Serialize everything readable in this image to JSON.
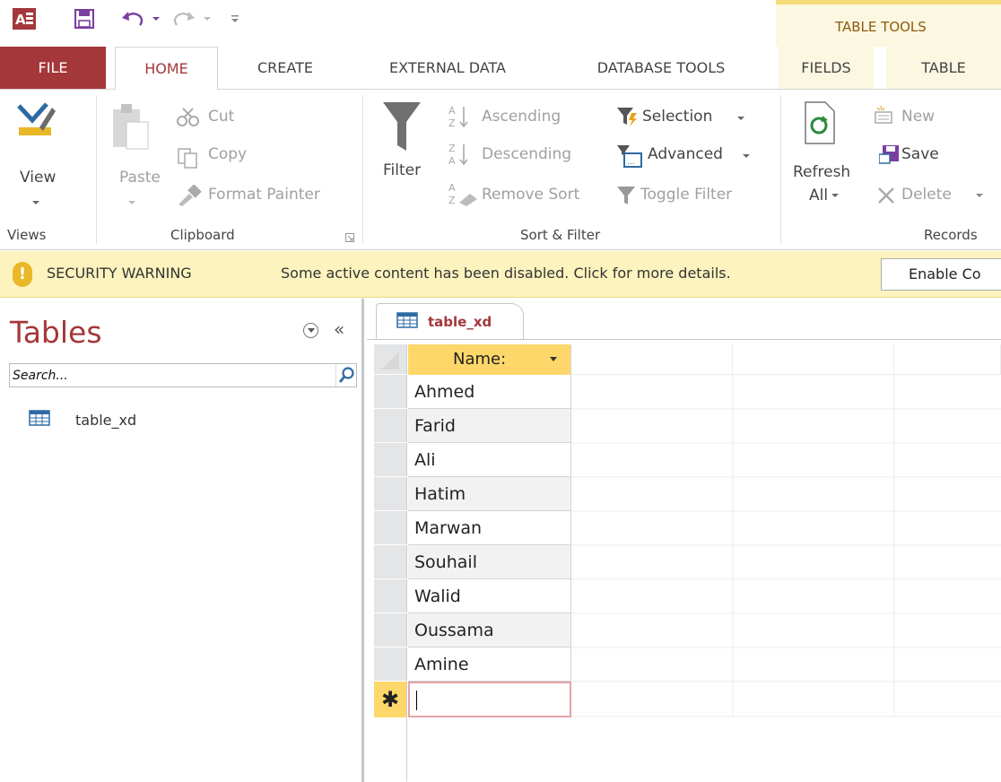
{
  "quick_access": {
    "app_icon": "access-app-icon",
    "save_icon": "save-icon",
    "undo_icon": "undo-icon",
    "redo_icon": "redo-icon",
    "customize_icon": "customize-toolbar-icon"
  },
  "contextual_tab_group": "TABLE TOOLS",
  "tabs": {
    "file": "FILE",
    "home": "HOME",
    "create": "CREATE",
    "external_data": "EXTERNAL DATA",
    "database_tools": "DATABASE TOOLS",
    "fields": "FIELDS",
    "table": "TABLE"
  },
  "ribbon": {
    "views": {
      "view": "View",
      "group": "Views"
    },
    "clipboard": {
      "paste": "Paste",
      "cut": "Cut",
      "copy": "Copy",
      "format_painter": "Format Painter",
      "group": "Clipboard"
    },
    "sort_filter": {
      "filter": "Filter",
      "ascending": "Ascending",
      "descending": "Descending",
      "remove_sort": "Remove Sort",
      "selection": "Selection",
      "advanced": "Advanced",
      "toggle_filter": "Toggle Filter",
      "group": "Sort & Filter"
    },
    "records": {
      "refresh": "Refresh",
      "refresh_all": "All",
      "new": "New",
      "save": "Save",
      "delete": "Delete",
      "group": "Records"
    }
  },
  "security_warning": {
    "title": "SECURITY WARNING",
    "message": "Some active content has been disabled. Click for more details.",
    "button": "Enable Co"
  },
  "nav_pane": {
    "title": "Tables",
    "search_placeholder": "Search...",
    "items": [
      {
        "label": "table_xd",
        "icon": "table-icon"
      }
    ]
  },
  "document": {
    "tab_label": "table_xd",
    "column_header": "Name:",
    "rows": [
      "Ahmed",
      "Farid",
      "Ali",
      "Hatim",
      "Marwan",
      "Souhail",
      "Walid",
      "Oussama",
      "Amine"
    ],
    "new_record_marker": "✱"
  },
  "colors": {
    "access_red": "#a4373a",
    "header_yellow": "#fdd769",
    "warning_bar": "#fdf3be",
    "context_tab_bg": "#fcf7e0"
  }
}
